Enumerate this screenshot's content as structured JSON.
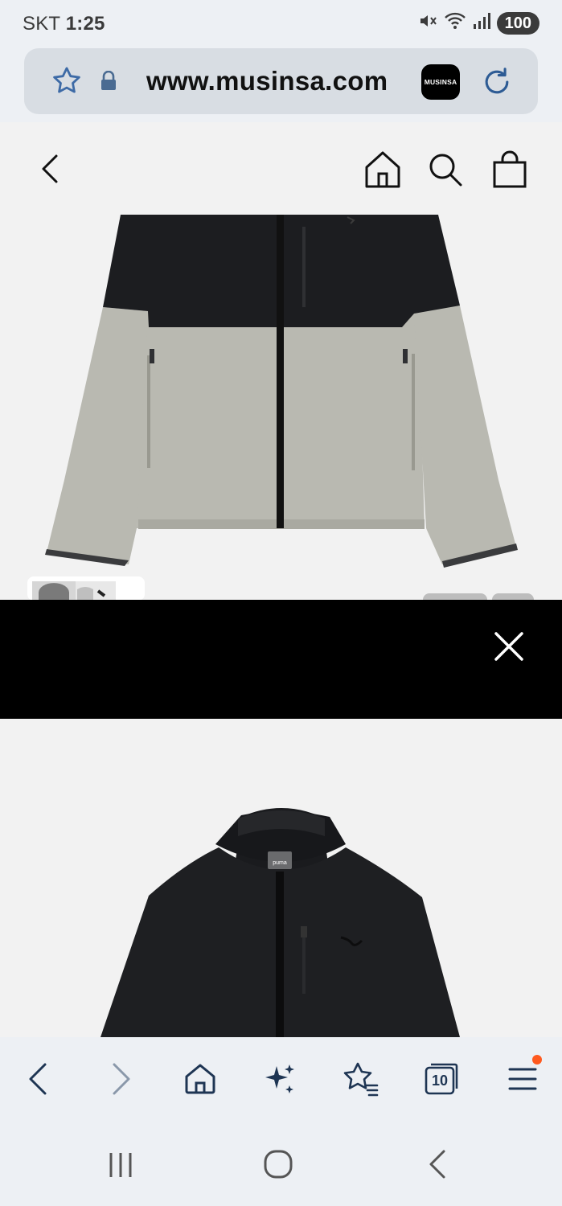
{
  "status_bar": {
    "carrier": "SKT",
    "time": "1:25",
    "battery": "100",
    "icons": [
      "mute-icon",
      "wifi-icon",
      "signal-icon"
    ]
  },
  "browser": {
    "url": "www.musinsa.com",
    "site_badge": "MUSINSA",
    "icons": [
      "bookmark-star-icon",
      "lock-icon",
      "reload-icon"
    ]
  },
  "page": {
    "header_icons": [
      "back-icon",
      "home-icon",
      "search-icon",
      "shopping-bag-icon"
    ],
    "hero_image": "fleece jacket, black top with light gray fleece bottom",
    "second_image": "black fleece jacket with stand collar",
    "second_logo": "puma",
    "close_icon": "close-icon"
  },
  "toolbar": {
    "tab_count": "10",
    "icons": [
      "back-icon",
      "forward-icon",
      "home-icon",
      "ai-sparkle-icon",
      "bookmarks-icon",
      "tabs-icon",
      "menu-icon"
    ]
  },
  "colors": {
    "chrome_bg": "#edf0f4",
    "url_bar_bg": "#d8dde3",
    "icon_navy": "#1e3553",
    "accent_blue": "#2d5b94",
    "notification": "#ff5a1f"
  }
}
